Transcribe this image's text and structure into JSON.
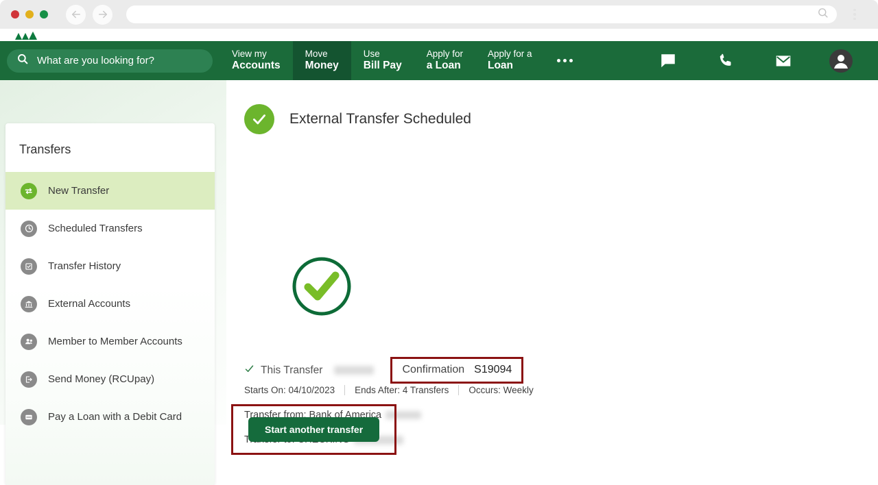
{
  "browser": {
    "url_value": "",
    "url_placeholder": "",
    "back_icon": "back-arrow-icon",
    "forward_icon": "forward-arrow-icon",
    "search_icon": "search-icon",
    "menu_icon": "kebab-menu-icon"
  },
  "header": {
    "search": {
      "placeholder": "What are you looking for?",
      "value": "",
      "icon": "search-icon"
    },
    "nav": [
      {
        "top": "View my",
        "bottom": "Accounts",
        "active": false
      },
      {
        "top": "Move",
        "bottom": "Money",
        "active": true
      },
      {
        "top": "Use",
        "bottom": "Bill Pay",
        "active": false
      },
      {
        "top": "Apply for",
        "bottom": "a Loan",
        "active": false
      },
      {
        "top": "Apply for a",
        "bottom": "Loan",
        "active": false
      }
    ],
    "more_label": "More",
    "icons": [
      {
        "name": "chat-icon"
      },
      {
        "name": "phone-icon"
      },
      {
        "name": "envelope-icon"
      },
      {
        "name": "user-avatar-icon"
      }
    ]
  },
  "sidebar": {
    "title": "Transfers",
    "items": [
      {
        "label": "New Transfer",
        "icon": "transfer-arrows-icon",
        "active": true
      },
      {
        "label": "Scheduled Transfers",
        "icon": "clock-icon",
        "active": false
      },
      {
        "label": "Transfer History",
        "icon": "history-checklist-icon",
        "active": false
      },
      {
        "label": "External Accounts",
        "icon": "bank-icon",
        "active": false
      },
      {
        "label": "Member to Member Accounts",
        "icon": "people-icon",
        "active": false
      },
      {
        "label": "Send Money (RCUpay)",
        "icon": "send-money-icon",
        "active": false
      },
      {
        "label": "Pay a Loan with a Debit Card",
        "icon": "card-icon",
        "active": false
      }
    ]
  },
  "main": {
    "page_title": "External Transfer Scheduled",
    "success_icon": "check-circle-icon",
    "big_success_icon": "large-check-circle-icon",
    "transfer_label": "This Transfer",
    "confirmation_label": "Confirmation",
    "confirmation_number": "S19094",
    "meta": [
      "Starts On: 04/10/2023",
      "Ends After: 4 Transfers",
      "Occurs: Weekly"
    ],
    "transfer_from": "Transfer from: Bank of America",
    "transfer_to": "Transfer to: CHECKING",
    "start_another_button": "Start another transfer"
  },
  "colors": {
    "brand_green": "#1b6b3a",
    "active_nav_green": "#145430",
    "accent_green": "#6cb52d",
    "button_green": "#156b3c",
    "highlight_red": "#8b1212",
    "active_row_green": "#dcedc0"
  }
}
